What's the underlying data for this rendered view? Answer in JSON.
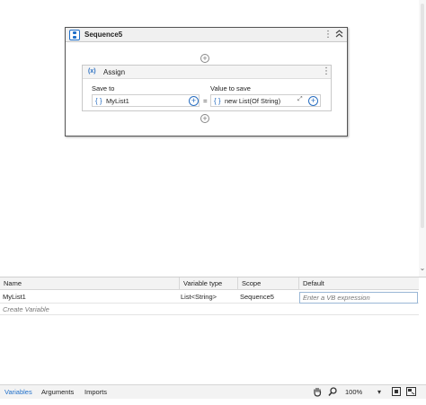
{
  "sequence": {
    "title": "Sequence5",
    "menu_glyph": "⋮",
    "collapse_glyph": "≈",
    "add_glyph": "+"
  },
  "assign": {
    "icon_text": "(x)",
    "title": "Assign",
    "menu_glyph": "⋮",
    "save_to_label": "Save to",
    "value_to_save_label": "Value to save",
    "save_to_value": "MyList1",
    "value_to_save_value": "new List(Of String)",
    "brace_glyph": "{ }",
    "equals": "=",
    "plus_glyph": "+",
    "expand_glyph": "⤢"
  },
  "variables": {
    "columns": [
      "Name",
      "Variable type",
      "Scope",
      "Default"
    ],
    "rows": [
      {
        "name": "MyList1",
        "type": "List<String>",
        "scope": "Sequence5",
        "default_placeholder": "Enter a VB expression"
      }
    ],
    "create_label": "Create Variable"
  },
  "bottom_bar": {
    "tabs": [
      "Variables",
      "Arguments",
      "Imports"
    ],
    "active_tab": "Variables",
    "zoom": "100%",
    "zoom_dropdown_glyph": "▾"
  },
  "colors": {
    "accent": "#1f6fc9"
  }
}
